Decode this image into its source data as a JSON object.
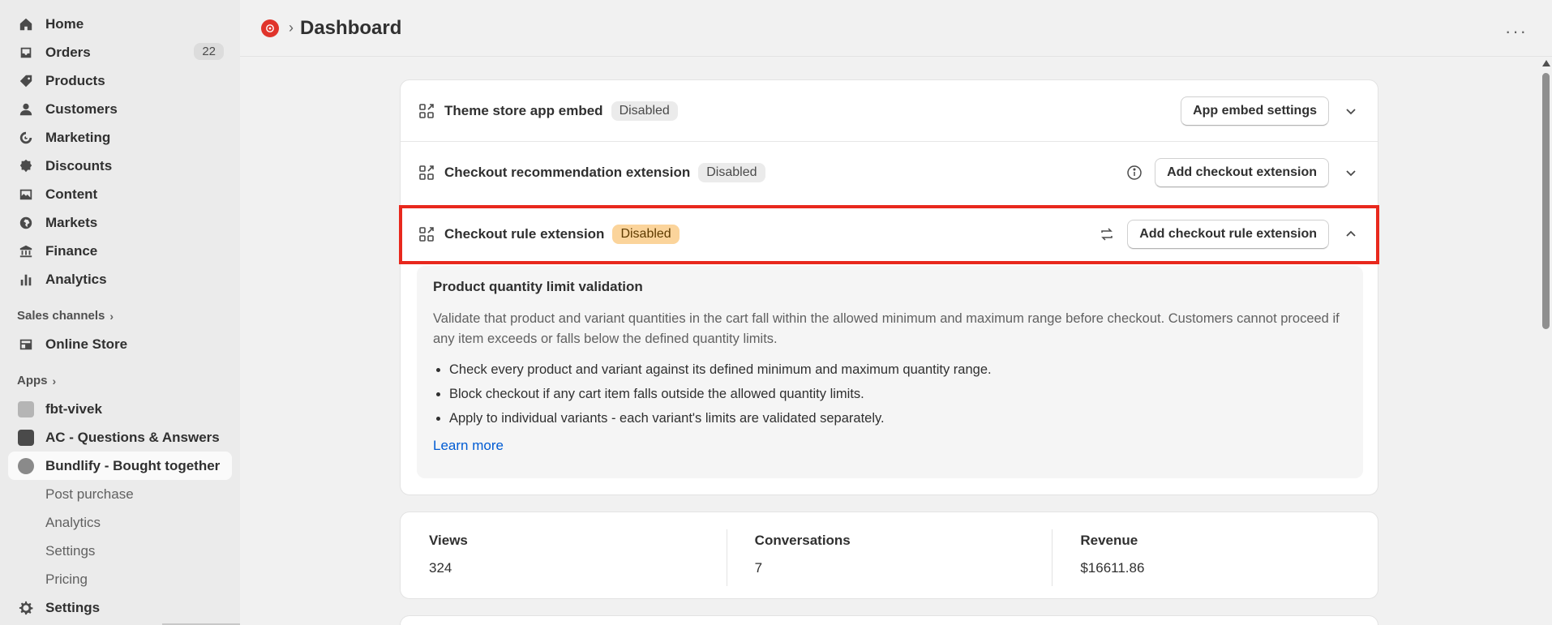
{
  "sidebar": {
    "nav": [
      {
        "label": "Home",
        "icon": "home-icon"
      },
      {
        "label": "Orders",
        "icon": "inbox-icon",
        "badge": "22"
      },
      {
        "label": "Products",
        "icon": "tag-icon"
      },
      {
        "label": "Customers",
        "icon": "person-icon"
      },
      {
        "label": "Marketing",
        "icon": "target-icon"
      },
      {
        "label": "Discounts",
        "icon": "discount-icon"
      },
      {
        "label": "Content",
        "icon": "image-icon"
      },
      {
        "label": "Markets",
        "icon": "globe-icon"
      },
      {
        "label": "Finance",
        "icon": "bank-icon"
      },
      {
        "label": "Analytics",
        "icon": "bar-chart-icon"
      }
    ],
    "sales_channels_label": "Sales channels",
    "online_store_label": "Online Store",
    "apps_label": "Apps",
    "apps": [
      {
        "label": "fbt-vivek"
      },
      {
        "label": "AC - Questions & Answers"
      },
      {
        "label": "Bundlify - Bought together"
      }
    ],
    "sub_items": [
      "Post purchase",
      "Analytics",
      "Settings",
      "Pricing"
    ],
    "settings_label": "Settings"
  },
  "header": {
    "title": "Dashboard"
  },
  "extensions": [
    {
      "title": "Theme store app embed",
      "status": "Disabled",
      "button": "App embed settings"
    },
    {
      "title": "Checkout recommendation extension",
      "status": "Disabled",
      "button": "Add checkout extension"
    },
    {
      "title": "Checkout rule extension",
      "status": "Disabled",
      "button": "Add checkout rule extension"
    }
  ],
  "detail": {
    "title": "Product quantity limit validation",
    "description": "Validate that product and variant quantities in the cart fall within the allowed minimum and maximum range before checkout. Customers cannot proceed if any item exceeds or falls below the defined quantity limits.",
    "bullets": [
      "Check every product and variant against its defined minimum and maximum quantity range.",
      "Block checkout if any cart item falls outside the allowed quantity limits.",
      "Apply to individual variants - each variant's limits are validated separately."
    ],
    "link": "Learn more"
  },
  "stats": [
    {
      "label": "Views",
      "value": "324"
    },
    {
      "label": "Conversations",
      "value": "7"
    },
    {
      "label": "Revenue",
      "value": "$16611.86"
    }
  ],
  "colors": {
    "highlight": "#e8281d",
    "link": "#005bd3",
    "badge_orange": "#fbd49b"
  }
}
